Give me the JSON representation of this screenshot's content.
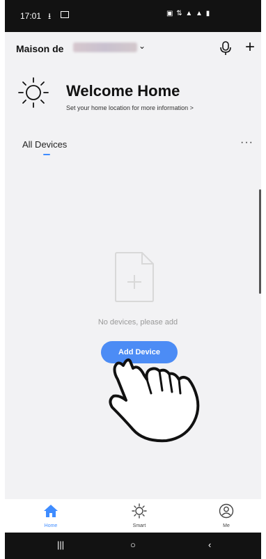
{
  "status_bar": {
    "time": "17:01",
    "download_icon": "download-icon",
    "image_icon": "image-icon",
    "right_icons": "signal-icons"
  },
  "header": {
    "home_name": "Maison de",
    "redacted": true
  },
  "welcome": {
    "title": "Welcome Home",
    "subtitle": "Set your home location for more information >"
  },
  "tabs": {
    "all_devices": "All Devices",
    "more": "···"
  },
  "empty_state": {
    "message": "No devices, please add",
    "add_button": "Add Device"
  },
  "bottom_nav": {
    "items": [
      {
        "label": "Home",
        "active": true,
        "icon": "home-icon"
      },
      {
        "label": "Smart",
        "active": false,
        "icon": "sun-icon"
      },
      {
        "label": "Me",
        "active": false,
        "icon": "profile-icon"
      }
    ]
  },
  "system_nav": {
    "recents": "|||",
    "home": "○",
    "back": "‹"
  },
  "colors": {
    "accent": "#3f8cff",
    "button": "#4c8cf5",
    "background": "#f2f2f4"
  }
}
